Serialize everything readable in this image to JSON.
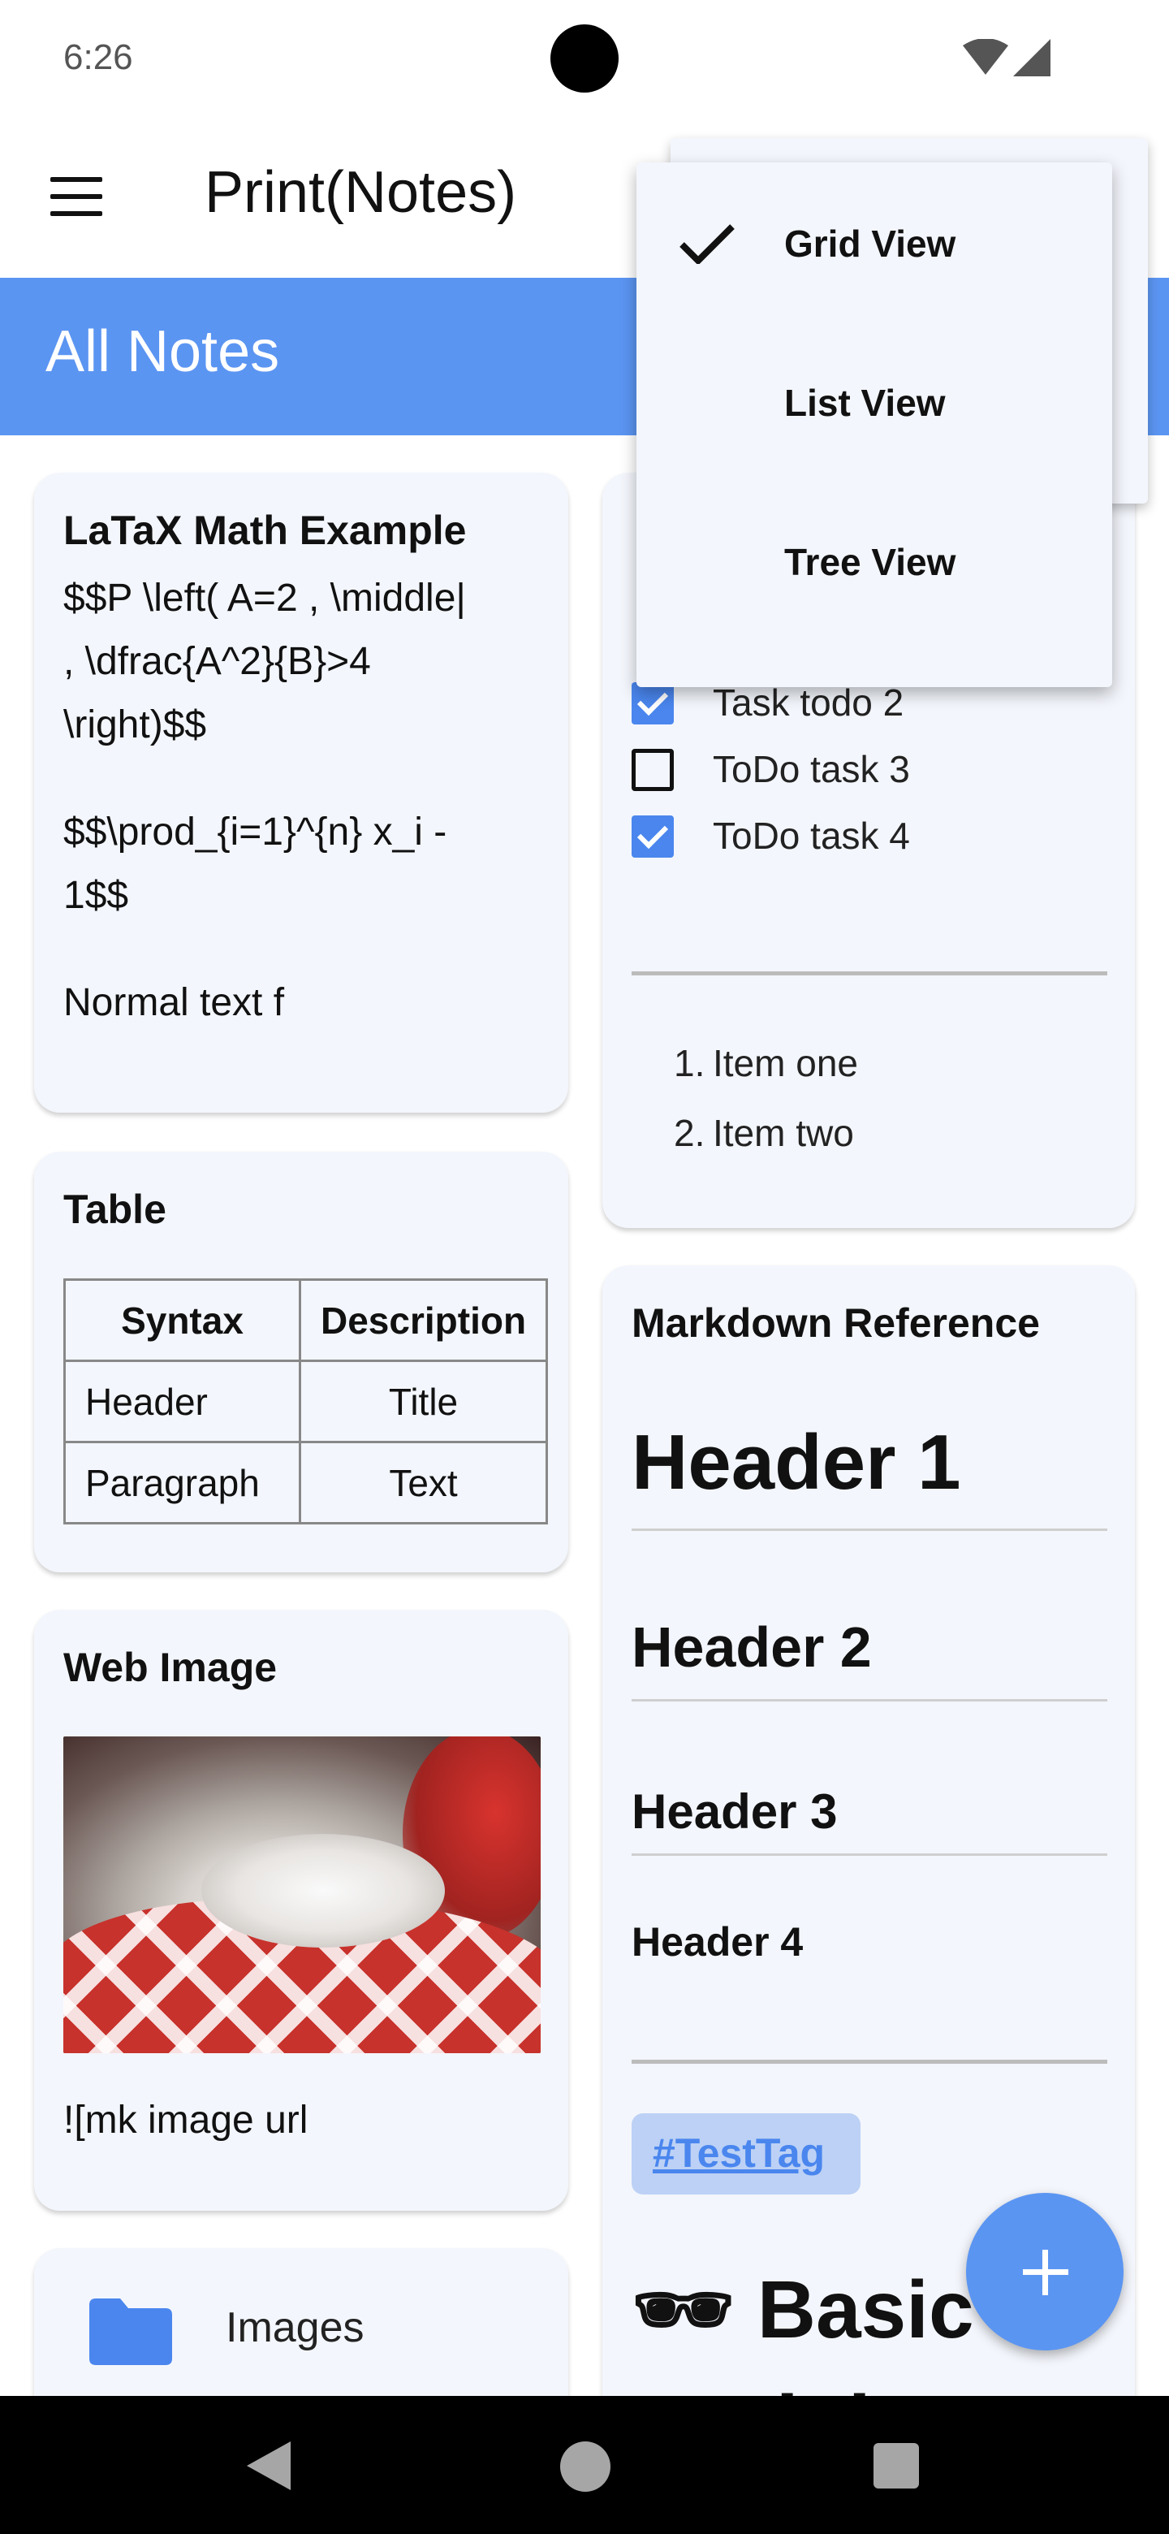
{
  "status_bar": {
    "time": "6:26"
  },
  "app_bar": {
    "title": "Print(Notes)"
  },
  "section": {
    "title": "All Notes"
  },
  "cards": {
    "latex": {
      "title": "LaTaX Math Example",
      "line1": "$$P \\left( A=2 , \\middle|",
      "line2": ", \\dfrac{A^2}{B}>4",
      "line3": "\\right)$$",
      "line4": "$$\\prod_{i=1}^{n} x_i -",
      "line5": "1$$",
      "line6": "Normal text f"
    },
    "table": {
      "title": "Table",
      "headers": [
        "Syntax",
        "Description"
      ],
      "rows": [
        [
          "Header",
          "Title"
        ],
        [
          "Paragraph",
          "Text"
        ]
      ]
    },
    "web_image": {
      "title": "Web Image",
      "caption": "![mk image url"
    },
    "folder": {
      "label": "Images"
    },
    "todo": {
      "items": [
        {
          "label": "Task todo 2",
          "checked": true
        },
        {
          "label": "ToDo task 3",
          "checked": false
        },
        {
          "label": "ToDo task 4",
          "checked": true
        }
      ],
      "ordered": [
        "Item one",
        "Item two"
      ],
      "ordered_numbers": [
        "1.",
        "2."
      ]
    },
    "markdown": {
      "title": "Markdown Reference",
      "h1": "Header 1",
      "h2": "Header 2",
      "h3": "Header 3",
      "h4": "Header 4",
      "tag": "#TestTag",
      "big_heading": "🕶 Basic",
      "big_heading_line2": "Markdown"
    }
  },
  "popup_menu": {
    "items": [
      {
        "label": "Grid View",
        "selected": true
      },
      {
        "label": "List View",
        "selected": false
      },
      {
        "label": "Tree View",
        "selected": false
      }
    ]
  },
  "colors": {
    "accent": "#5b95f2",
    "card": "#f3f6fc",
    "checkbox": "#4a86ee"
  },
  "icons": {
    "menu": "hamburger-icon",
    "folder": "folder-icon",
    "fab": "plus-icon",
    "check": "checkmark-icon"
  }
}
